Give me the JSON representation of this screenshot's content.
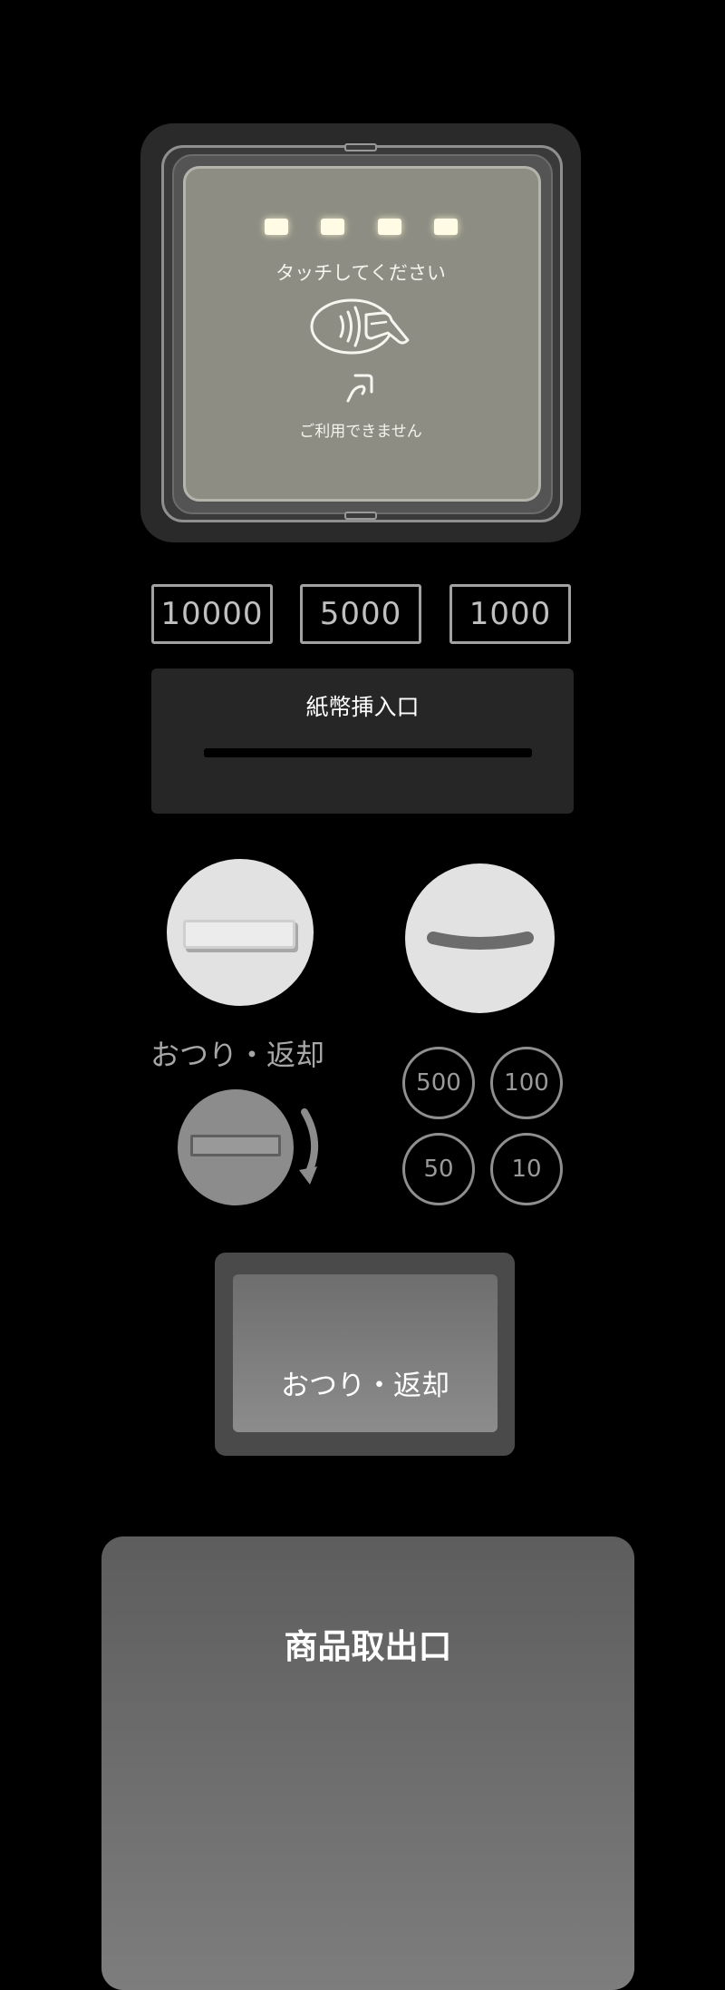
{
  "card_reader": {
    "prompt": "タッチしてください",
    "status": "ご利用できません",
    "leds": 4,
    "icon": "contactless-payment-icon",
    "status_icon": "hand-tap-icon"
  },
  "bill_denominations": [
    "10000",
    "5000",
    "1000"
  ],
  "bill_slot": {
    "label": "紙幣挿入口"
  },
  "coin_return": {
    "label": "おつり・返却"
  },
  "coin_denominations": [
    "500",
    "100",
    "50",
    "10"
  ],
  "change_tray": {
    "label": "おつり・返却"
  },
  "product_outlet": {
    "label": "商品取出口"
  },
  "colors": {
    "background": "#000000",
    "reader_screen": "#8d8d83",
    "led": "#fffbe4",
    "button": "#e2e2e2"
  }
}
